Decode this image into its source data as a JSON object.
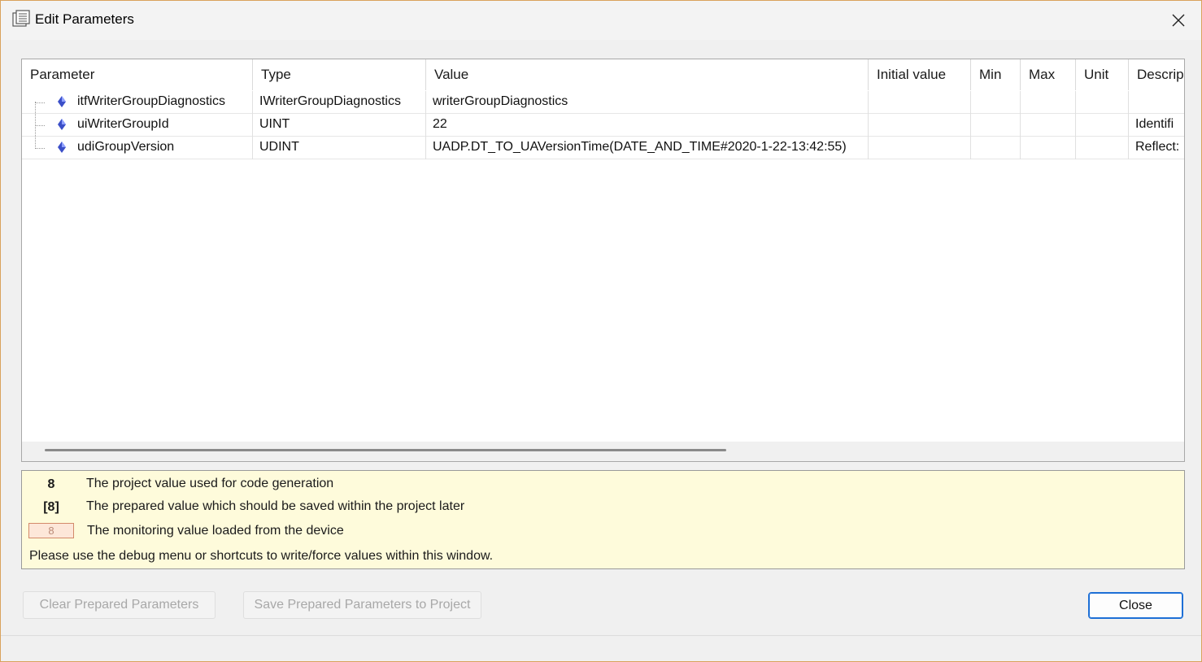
{
  "window": {
    "title": "Edit Parameters",
    "app_icon": "parameters-list-icon",
    "close_icon": "close-icon"
  },
  "table": {
    "columns": [
      "Parameter",
      "Type",
      "Value",
      "Initial value",
      "Min",
      "Max",
      "Unit",
      "Descrip"
    ],
    "rows": [
      {
        "parameter": "itfWriterGroupDiagnostics",
        "type": "IWriterGroupDiagnostics",
        "value": "writerGroupDiagnostics",
        "initial": "",
        "min": "",
        "max": "",
        "unit": "",
        "description": ""
      },
      {
        "parameter": "uiWriterGroupId",
        "type": "UINT",
        "value": "22",
        "initial": "",
        "min": "",
        "max": "",
        "unit": "",
        "description": "Identifi"
      },
      {
        "parameter": "udiGroupVersion",
        "type": "UDINT",
        "value": "UADP.DT_TO_UAVersionTime(DATE_AND_TIME#2020-1-22-13:42:55)",
        "initial": "",
        "min": "",
        "max": "",
        "unit": "",
        "description": "Reflect:"
      }
    ],
    "row_icon": "variable-diamond-icon"
  },
  "legend": {
    "items": [
      {
        "symbol": "8",
        "text": "The project value used for code generation"
      },
      {
        "symbol": "[8]",
        "text": "The prepared value which should be saved within the project later"
      },
      {
        "symbol": "8",
        "text": "The monitoring value loaded from the device"
      }
    ],
    "note": "Please use the debug menu or shortcuts to write/force values within this window."
  },
  "buttons": {
    "clear": "Clear Prepared Parameters",
    "save": "Save Prepared Parameters to Project",
    "close": "Close"
  },
  "colors": {
    "accent": "#1d6fd6",
    "legend_bg": "#fefbdb",
    "icon_blue": "#3b4fc8"
  }
}
